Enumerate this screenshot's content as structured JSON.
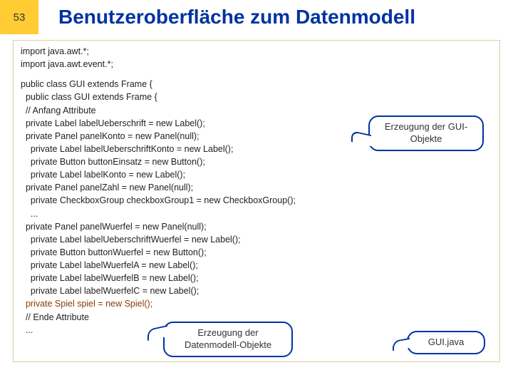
{
  "header": {
    "pagenum": "53",
    "title": "Benutzeroberfläche zum Datenmodell"
  },
  "code": {
    "imports": "import java.awt.*;\nimport java.awt.event.*;",
    "block1": "public class GUI extends Frame {\n  public class GUI extends Frame {\n  // Anfang Attribute\n  private Label labelUeberschrift = new Label();\n  private Panel panelKonto = new Panel(null);\n    private Label labelUeberschriftKonto = new Label();\n    private Button buttonEinsatz = new Button();\n    private Label labelKonto = new Label();\n  private Panel panelZahl = new Panel(null);\n    private CheckboxGroup checkboxGroup1 = new CheckboxGroup();\n    ...\n  private Panel panelWuerfel = new Panel(null);\n    private Label labelUeberschriftWuerfel = new Label();\n    private Button buttonWuerfel = new Button();\n    private Label labelWuerfelA = new Label();\n    private Label labelWuerfelB = new Label();\n    private Label labelWuerfelC = new Label();",
    "spiel": "  private Spiel spiel = new Spiel();",
    "end": "  // Ende Attribute\n  ..."
  },
  "callouts": {
    "c1": "Erzeugung der GUI-Objekte",
    "c2": "Erzeugung der Datenmodell-Objekte",
    "c3": "GUI.java"
  }
}
